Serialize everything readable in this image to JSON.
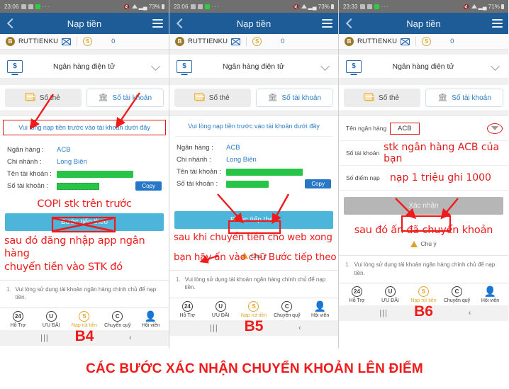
{
  "caption": "CÁC BƯỚC XÁC NHẬN CHUYỂN KHOẢN LÊN ĐIỂM",
  "colors": {
    "appbar": "#1d5c96",
    "accent_blue": "#2b7cc4",
    "cta_blue": "#4db5da",
    "cta_gray": "#b6b6b6",
    "annotation_red": "#ef1b1b",
    "gold": "#e0a52c",
    "redact_green": "#27c447"
  },
  "common": {
    "appbar_title": "Nạp tiền",
    "username": "RUTTIENKU",
    "avatar_letter": "B",
    "coin_letter": "S",
    "balance": "0",
    "method_label": "Ngân hàng điện tử",
    "method_icon_text": "$",
    "tab_card": "Số thẻ",
    "tab_account": "Số tài khoản",
    "footnote_num": "1.",
    "footnote_text": "Vui lòng sử dụng tài khoản ngân hàng chính chủ để nạp tiền.",
    "warning_text": "Chú ý",
    "nav": [
      {
        "icon": "24",
        "label": "Hỗ Trợ",
        "active": false
      },
      {
        "icon": "U",
        "label": "ƯU ĐÃI",
        "active": false
      },
      {
        "icon": "S",
        "label": "Nạp rút tiền",
        "active": true
      },
      {
        "icon": "C",
        "label": "Chuyển quỹ",
        "active": false
      },
      {
        "icon": "person",
        "label": "Hội viên",
        "active": false
      }
    ],
    "sysbar_recent": "|||",
    "sysbar_back": "‹"
  },
  "panels": [
    {
      "id": "panel-b4",
      "step": "B4",
      "status": {
        "time": "23:06",
        "battery": "73%"
      },
      "notice": "Vui lòng nạp tiền trước vào tài khoản dưới đây",
      "notice_boxed": true,
      "info_rows": [
        {
          "label": "Ngân hàng :",
          "value": "ACB",
          "type": "text"
        },
        {
          "label": "Chi nhánh :",
          "value": "Long Biên",
          "type": "text"
        },
        {
          "label": "Tên tài khoản :",
          "value": "",
          "type": "redacted-wide"
        },
        {
          "label": "Số tài khoản :",
          "value": "",
          "type": "redacted-dashed"
        }
      ],
      "copy_label": "Copy",
      "cta_label": "Bước tiếp theo",
      "cta_style": "blue",
      "cta_crossed": true,
      "annotations": {
        "above_cta": "COPI stk trên trước",
        "below_cta_line1": "sau đó đăng nhập app ngân hàng",
        "below_cta_line2": "chuyển tiền vào STK đó"
      },
      "show_warning": false
    },
    {
      "id": "panel-b5",
      "step": "B5",
      "status": {
        "time": "23:06",
        "battery": "73%"
      },
      "notice": "Vui lòng nạp tiền trước vào tài khoản dưới đây",
      "notice_boxed": false,
      "info_rows": [
        {
          "label": "Ngân hàng :",
          "value": "ACB",
          "type": "text"
        },
        {
          "label": "Chi nhánh :",
          "value": "Long Biên",
          "type": "text"
        },
        {
          "label": "Tên tài khoản :",
          "value": "",
          "type": "redacted-wide"
        },
        {
          "label": "Số tài khoản :",
          "value": "",
          "type": "redacted-narrow"
        }
      ],
      "copy_label": "Copy",
      "cta_label": "Bước tiếp theo",
      "cta_style": "blue",
      "cta_crossed": false,
      "cta_boxed": true,
      "annotations": {
        "below_cta_line1": "sau khi chuyển tiền cho web xong",
        "below_cta_line2": "bạn hãy ấn vào chữ Bước tiếp theo"
      },
      "show_warning": true
    },
    {
      "id": "panel-b6",
      "step": "B6",
      "status": {
        "time": "23:33",
        "battery": "71%"
      },
      "form_rows": [
        {
          "label": "Tên ngân hàng",
          "value": "ACB",
          "type": "boxed-select",
          "has_dropdown": true
        },
        {
          "label": "Số tài khoản",
          "value": "stk ngân hàng ACB của bạn",
          "type": "handwritten"
        },
        {
          "label": "Số điểm nạp",
          "value": "nạp 1 triệu ghi 1000",
          "type": "handwritten"
        }
      ],
      "cta_label": "Xác nhận",
      "cta_style": "gray",
      "cta_boxed": true,
      "annotations": {
        "below_cta_line1": "sau đó ấn đã chuyển khoản"
      },
      "show_warning": true
    }
  ]
}
